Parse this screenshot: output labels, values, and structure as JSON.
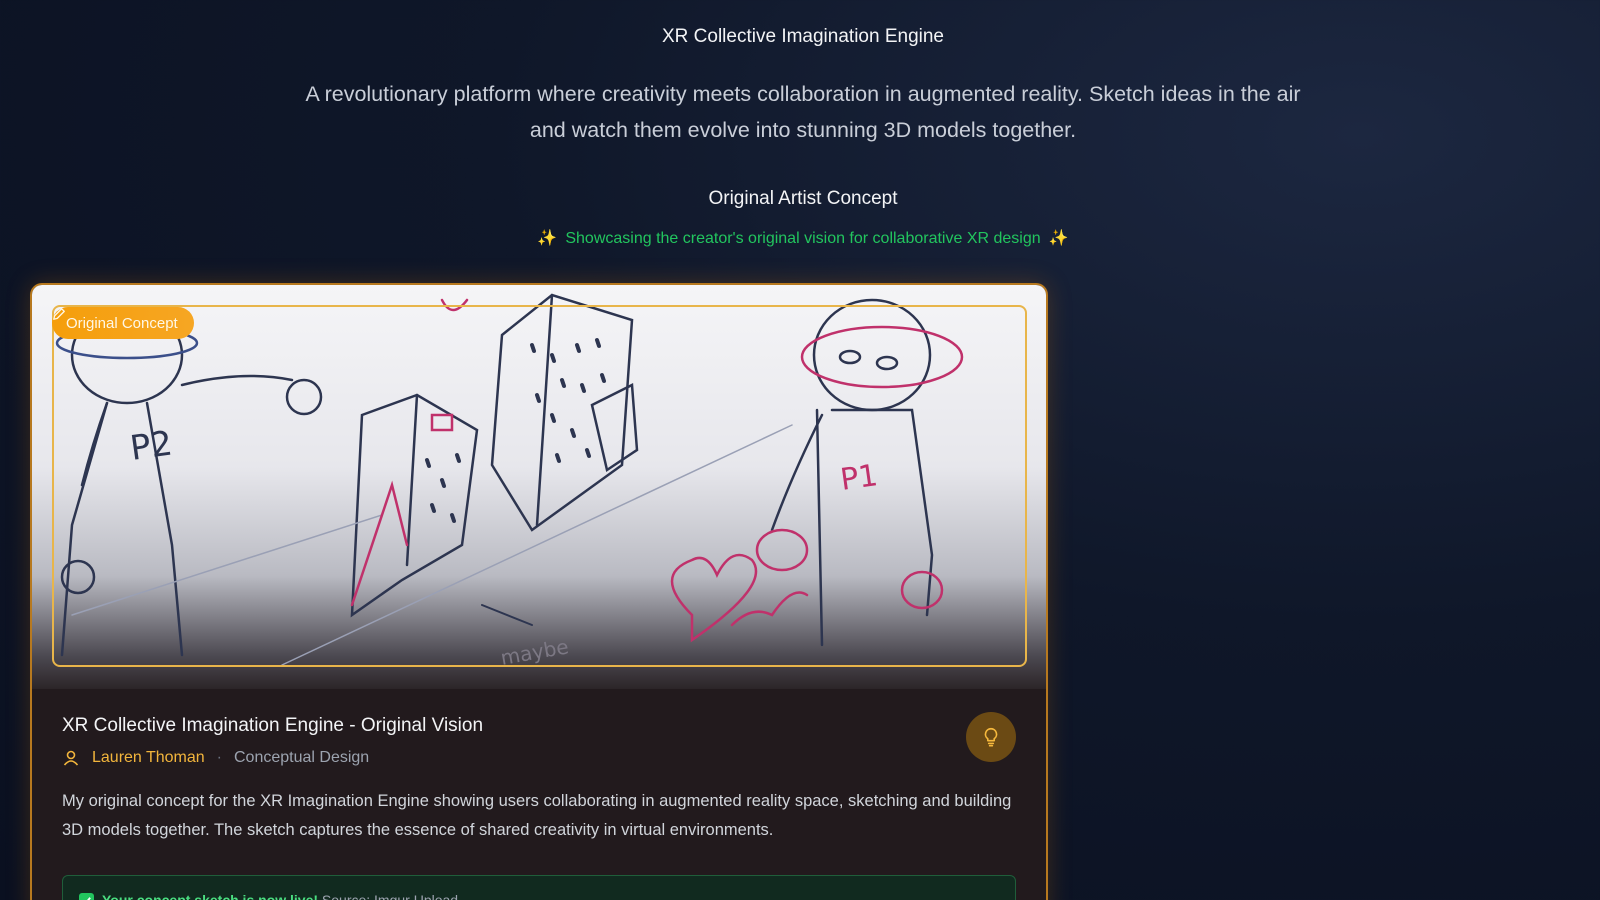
{
  "header": {
    "title": "XR Collective Imagination Engine",
    "description": "A revolutionary platform where creativity meets collaboration in augmented reality. Sketch ideas in the air and watch them evolve into stunning 3D models together."
  },
  "section": {
    "title": "Original Artist Concept",
    "subtitle": "Showcasing the creator's original vision for collaborative XR design",
    "sparkle_icon": "sparkle-icon"
  },
  "card": {
    "badge_label": "Original Concept",
    "badge_icon": "pencil-icon",
    "image_icon": "concept-sketch",
    "title": "XR Collective Imagination Engine - Original Vision",
    "author": "Lauren Thoman",
    "category": "Conceptual Design",
    "separator": "·",
    "description": "My original concept for the XR Imagination Engine showing users collaborating in augmented reality space, sketching and building 3D models together. The sketch captures the essence of shared creativity in virtual environments.",
    "notice": {
      "strong": "Your concept sketch is now live!",
      "source": "Source: Imgur Upload"
    }
  },
  "colors": {
    "accent": "#f59e0b",
    "success": "#22c55e",
    "background": "#0f1729"
  }
}
